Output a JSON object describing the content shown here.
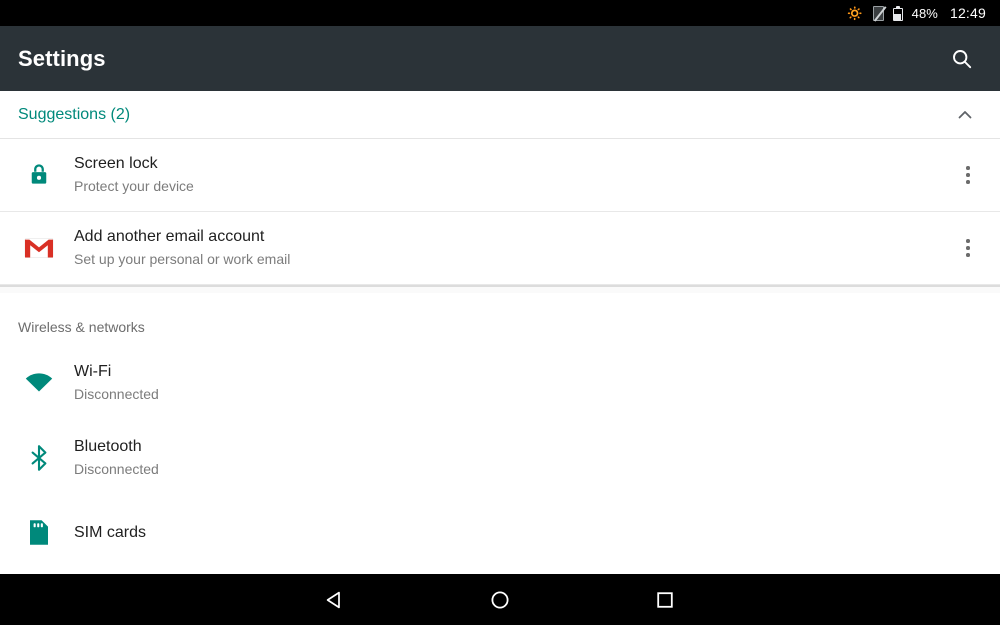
{
  "status_bar": {
    "bluetooth_icon": "bluetooth-icon",
    "no_sim_icon": "no-sim-icon",
    "battery_icon": "battery-icon",
    "battery_percent": "48%",
    "clock": "12:49"
  },
  "app_bar": {
    "title": "Settings",
    "search_icon": "search-icon"
  },
  "suggestions": {
    "header_label": "Suggestions (2)",
    "collapse_icon": "chevron-up-icon",
    "accent_color": "#00897b",
    "items": [
      {
        "icon": "lock-icon",
        "title": "Screen lock",
        "subtitle": "Protect your device",
        "overflow_icon": "overflow-menu-icon"
      },
      {
        "icon": "gmail-icon",
        "title": "Add another email account",
        "subtitle": "Set up your personal or work email",
        "overflow_icon": "overflow-menu-icon"
      }
    ]
  },
  "sections": [
    {
      "label": "Wireless & networks",
      "items": [
        {
          "icon": "wifi-icon",
          "title": "Wi-Fi",
          "subtitle": "Disconnected"
        },
        {
          "icon": "bluetooth-icon",
          "title": "Bluetooth",
          "subtitle": "Disconnected"
        },
        {
          "icon": "sim-card-icon",
          "title": "SIM cards",
          "subtitle": ""
        }
      ]
    }
  ],
  "nav_bar": {
    "back": "back-icon",
    "home": "home-icon",
    "recents": "recents-icon"
  }
}
